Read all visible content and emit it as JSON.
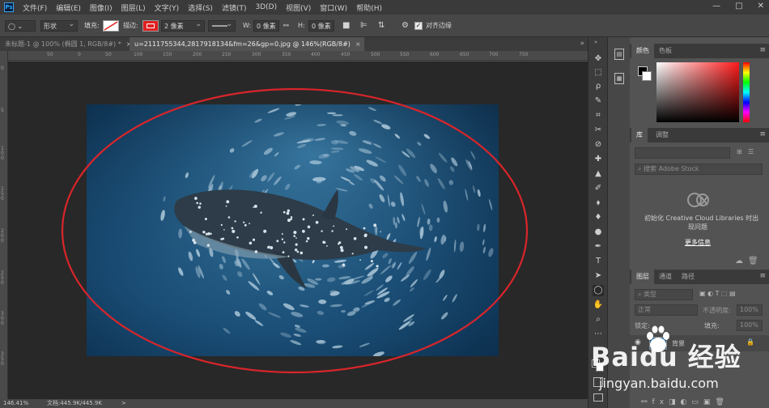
{
  "app": {
    "logo": "Ps"
  },
  "menu": [
    "文件(F)",
    "编辑(E)",
    "图像(I)",
    "图层(L)",
    "文字(Y)",
    "选择(S)",
    "滤镜(T)",
    "3D(D)",
    "视图(V)",
    "窗口(W)",
    "帮助(H)"
  ],
  "window_controls": [
    "—",
    "□",
    "✕"
  ],
  "options": {
    "shape_mode": "形状",
    "fill_label": "填充:",
    "stroke_label": "描边:",
    "stroke_width": "2 像素",
    "w_label": "W:",
    "w_value": "0 像素",
    "h_label": "H:",
    "h_value": "0 像素",
    "align_edges_label": "对齐边缘",
    "stroke_color": "#e02020",
    "fill_icon": "no-fill-slash"
  },
  "tabs": [
    {
      "label": "未标题-1 @ 100% (椭圆 1, RGB/8#) *",
      "close": "×"
    },
    {
      "label": "u=2111755344,2817918134&fm=26&gp=0.jpg @ 146%(RGB/8#)",
      "close": "×"
    }
  ],
  "ruler_top": [
    "50",
    "0",
    "50",
    "100",
    "150",
    "200",
    "250",
    "300",
    "350",
    "400",
    "450",
    "500",
    "550",
    "600",
    "650",
    "700",
    "750"
  ],
  "ruler_left": [
    "0",
    "5",
    "1\n0\n0",
    "1\n5\n0",
    "2\n0\n0",
    "2\n5\n0",
    "3\n0\n0",
    "3\n5\n0"
  ],
  "status": {
    "zoom": "146.41%",
    "doc": "文档:445.9K/445.9K",
    "arrow": ">"
  },
  "tools": [
    "✥",
    "⬚",
    "ρ",
    "✎",
    "⌗",
    "✂",
    "⊘",
    "✚",
    "▲",
    "✐",
    "⬧",
    "♦",
    "●",
    "✒",
    "T",
    "➤",
    "◯",
    "✋",
    "⌕",
    "⋯"
  ],
  "color_panel": {
    "tabs": [
      "颜色",
      "色板"
    ]
  },
  "library_panel": {
    "tabs": [
      "库",
      "调整"
    ],
    "search_placeholder": "搜索 Adobe Stock",
    "message_line1": "初始化 Creative Cloud Libraries 时出",
    "message_line2": "现问题",
    "more_info": "更多信息"
  },
  "layers_panel": {
    "tabs": [
      "图层",
      "通道",
      "路径"
    ],
    "kind_label": "类型",
    "blend_mode": "正常",
    "opacity_label": "不透明度:",
    "opacity_value": "100%",
    "lock_label": "锁定:",
    "fill_label": "填充:",
    "fill_value": "100%",
    "layer_name": "背景"
  },
  "watermark": {
    "brand": "Baidu 经验",
    "url": "jingyan.baidu.com"
  },
  "colors": {
    "ellipse_stroke": "#d9252a",
    "accent": "#31a8ff"
  }
}
